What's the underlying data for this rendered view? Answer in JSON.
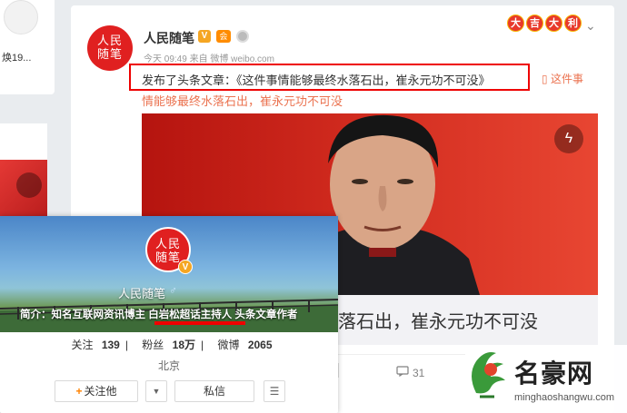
{
  "left": {
    "snippet": "焕19..."
  },
  "post": {
    "username": "人民随笔",
    "badge_v": "V",
    "badge_w": "会",
    "avatar_text_1": "人民",
    "avatar_text_2": "随笔",
    "meta": "今天 09:49 来自 微博 weibo.com",
    "lucky": [
      "大",
      "吉",
      "大",
      "利"
    ],
    "text_prefix": "发布了头条文章：",
    "text_link": "《这件事情能够最终水落石出，崔永元功不可没》",
    "article_side": "▯ 这件事",
    "article_cont": "情能够最终水落石出，崔永元功不可没",
    "headline": "落石出，崔永元功不可没",
    "comment_count": "31",
    "chevron": "⌄",
    "flash": "ϟ"
  },
  "popup": {
    "avatar_text_1": "人民",
    "avatar_text_2": "随笔",
    "vbadge": "V",
    "name": "人民随笔",
    "gender": "♂",
    "bio": "简介：知名互联网资讯博主 白岩松超话主持人 头条文章作者",
    "stats": {
      "follow_label": "关注",
      "follow_count": "139",
      "fans_label": "粉丝",
      "fans_count": "18万",
      "weibo_label": "微博",
      "weibo_count": "2065"
    },
    "location": "北京",
    "follow_btn": "关注他",
    "follow_plus": "+",
    "drop_btn": "▼",
    "msg_btn": "私信",
    "menu_btn": "☰"
  },
  "watermark": {
    "title": "名豪网",
    "url": "minghaoshangwu.com"
  },
  "colors": {
    "accent_orange": "#eb7350",
    "highlight_red": "#ee0000",
    "avatar_red": "#e02020",
    "follow_plus": "#ff8200"
  }
}
